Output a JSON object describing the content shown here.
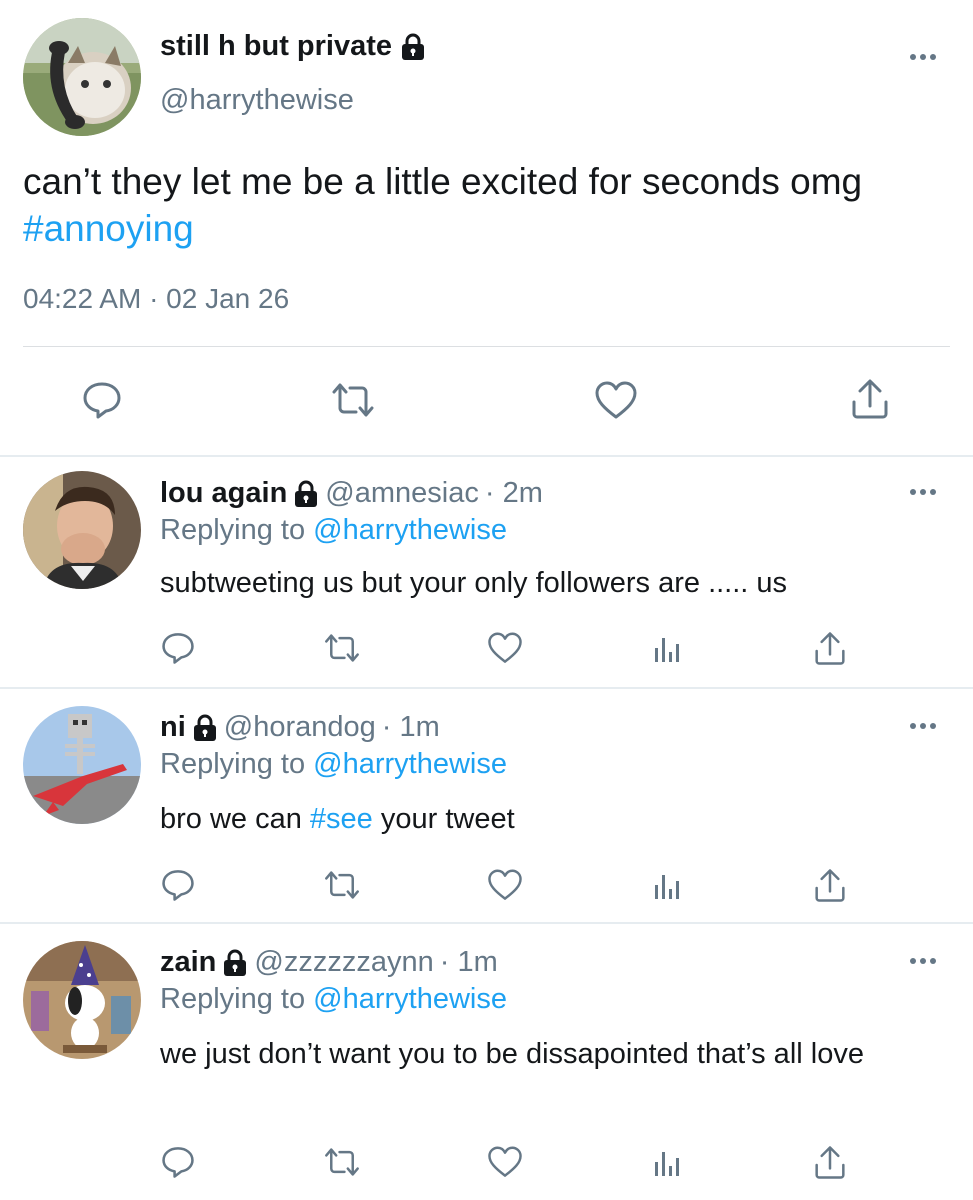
{
  "main_tweet": {
    "display_name": "still h but private",
    "handle": "@harrythewise",
    "text_plain": "can’t they let me be a little excited for seconds omg ",
    "hashtag": "#annoying",
    "timestamp": "04:22 AM · 02 Jan 26",
    "avatar_icon": "cat-phone-avatar",
    "actions": [
      "reply-icon",
      "retweet-icon",
      "like-icon",
      "share-icon"
    ]
  },
  "replies": [
    {
      "display_name": "lou again",
      "handle": "@amnesiac",
      "time": "· 2m",
      "replying_prefix": "Replying to",
      "replying_handle": "@harrythewise",
      "text_before": "subtweeting us but your only followers are ..... us",
      "hashtag": "",
      "text_after": "",
      "avatar_icon": "person-hand-face-avatar"
    },
    {
      "display_name": "ni",
      "handle": "@horandog",
      "time": "· 1m",
      "replying_prefix": "Replying to",
      "replying_handle": "@harrythewise",
      "text_before": "bro we can ",
      "hashtag": "#see",
      "text_after": " your tweet",
      "avatar_icon": "skeleton-guitar-avatar"
    },
    {
      "display_name": "zain",
      "handle": "@zzzzzzaynn",
      "time": "· 1m",
      "replying_prefix": "Replying to",
      "replying_handle": "@harrythewise",
      "text_before": "we just don’t want you to be dissapointed that’s all love",
      "hashtag": "",
      "text_after": "",
      "avatar_icon": "snoopy-wizard-avatar"
    }
  ],
  "reply_actions": [
    "reply-icon",
    "retweet-icon",
    "like-icon",
    "analytics-icon",
    "share-icon"
  ],
  "colors": {
    "accent": "#1da1f2",
    "secondary_text": "#657786",
    "icon": "#657786",
    "divider": "#e6ecf0"
  }
}
